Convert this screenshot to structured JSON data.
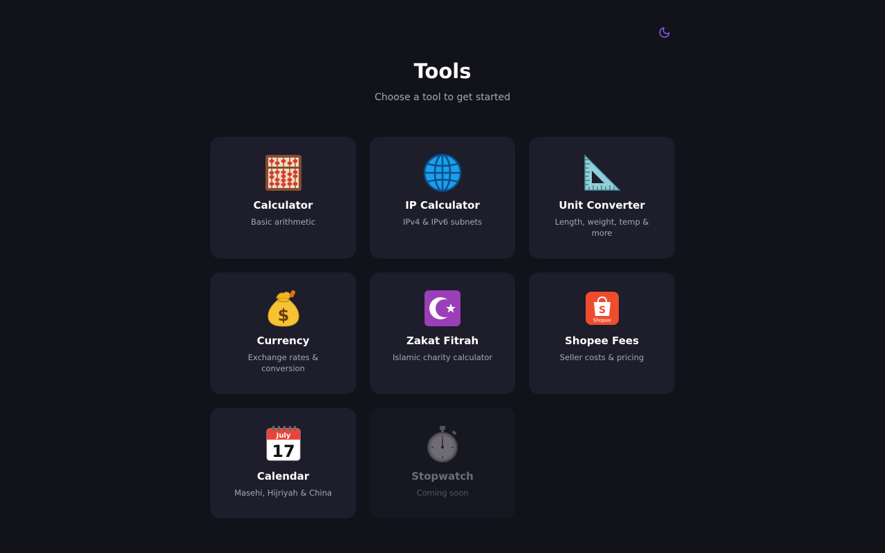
{
  "header": {
    "title": "Tools",
    "subtitle": "Choose a tool to get started"
  },
  "theme_toggle": {
    "icon": "moon-icon",
    "color": "#8b5cf6"
  },
  "tools": [
    {
      "name": "Calculator",
      "description": "Basic arithmetic",
      "icon": "abacus-icon",
      "enabled": true
    },
    {
      "name": "IP Calculator",
      "description": "IPv4 & IPv6 subnets",
      "icon": "globe-icon",
      "enabled": true
    },
    {
      "name": "Unit Converter",
      "description": "Length, weight, temp & more",
      "icon": "triangular-ruler-icon",
      "enabled": true
    },
    {
      "name": "Currency",
      "description": "Exchange rates & conversion",
      "icon": "money-bag-icon",
      "enabled": true
    },
    {
      "name": "Zakat Fitrah",
      "description": "Islamic charity calculator",
      "icon": "star-and-crescent-icon",
      "enabled": true
    },
    {
      "name": "Shopee Fees",
      "description": "Seller costs & pricing",
      "icon": "shopee-icon",
      "enabled": true,
      "brand_color": "#ee4d2d",
      "brand_text": "Shopee"
    },
    {
      "name": "Calendar",
      "description": "Masehi, Hijriyah & China",
      "icon": "calendar-icon",
      "enabled": true,
      "calendar_month": "July",
      "calendar_day": "17"
    },
    {
      "name": "Stopwatch",
      "description": "Coming soon",
      "icon": "stopwatch-icon",
      "enabled": false
    }
  ],
  "colors": {
    "background": "#12121a",
    "card": "#1d1d2b",
    "card_disabled": "#171722",
    "accent": "#8b5cf6"
  }
}
